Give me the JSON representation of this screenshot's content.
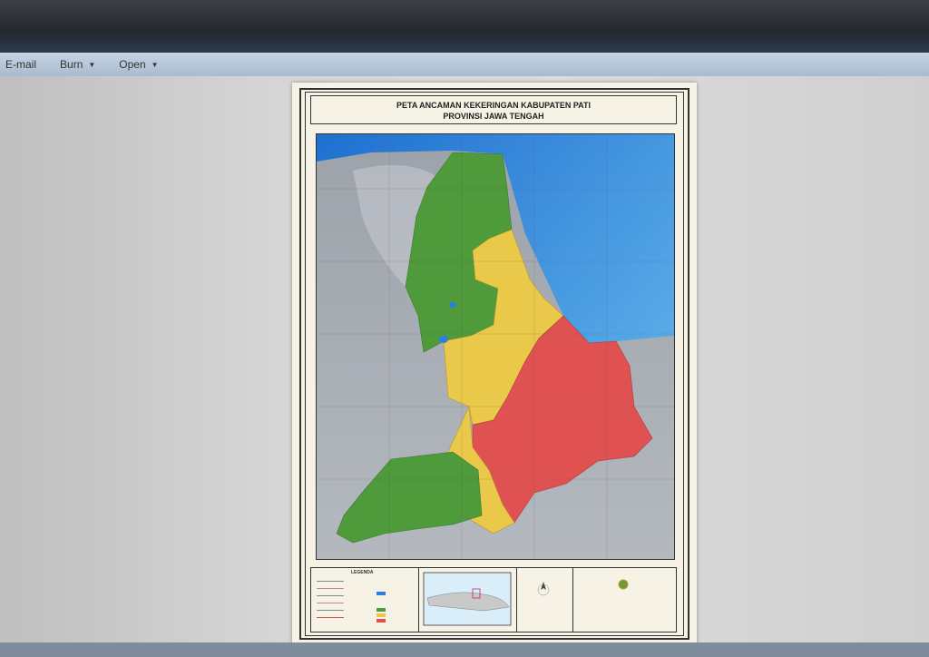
{
  "toolbar": {
    "email_label": "E-mail",
    "burn_label": "Burn",
    "open_label": "Open"
  },
  "map": {
    "title_line1": "PETA ANCAMAN KEKERINGAN KABUPATEN PATI",
    "title_line2": "PROVINSI JAWA TENGAH",
    "legend_title": "LEGENDA"
  },
  "colors": {
    "sea": "#3a8fdc",
    "land": "#a9aeb6",
    "high_threat": "#e05252",
    "medium_threat": "#eac84a",
    "low_threat": "#4f9a3b"
  }
}
